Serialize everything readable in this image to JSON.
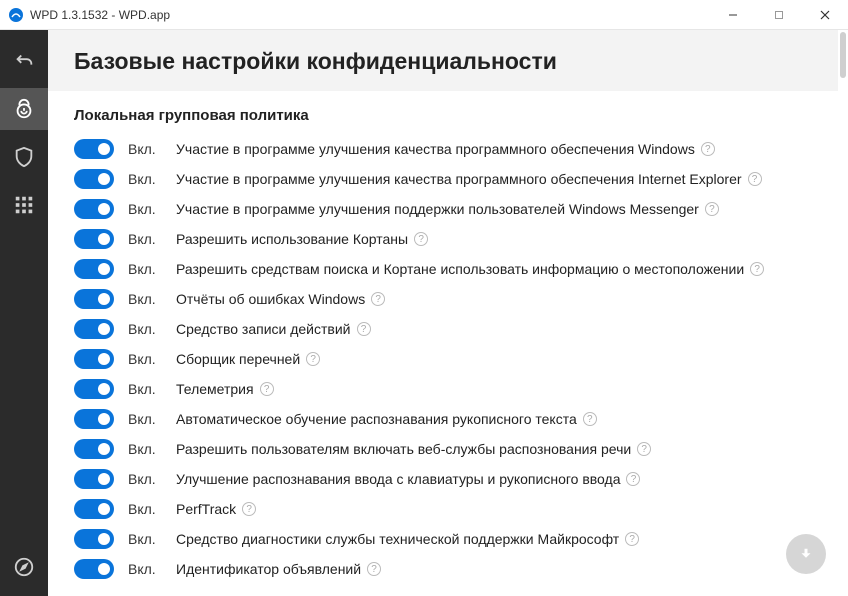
{
  "window": {
    "title": "WPD 1.3.1532 - WPD.app"
  },
  "page": {
    "heading": "Базовые настройки конфиденциальности",
    "section": "Локальная групповая политика"
  },
  "status_on": "Вкл.",
  "settings": [
    {
      "label": "Участие в программе улучшения качества программного обеспечения Windows",
      "on": true
    },
    {
      "label": "Участие в программе улучшения качества программного обеспечения Internet Explorer",
      "on": true
    },
    {
      "label": "Участие в программе улучшения поддержки пользователей Windows Messenger",
      "on": true
    },
    {
      "label": "Разрешить использование Кортаны",
      "on": true
    },
    {
      "label": "Разрешить средствам поиска и Кортане использовать информацию о местоположении",
      "on": true
    },
    {
      "label": "Отчёты об ошибках Windows",
      "on": true
    },
    {
      "label": "Средство записи действий",
      "on": true
    },
    {
      "label": "Сборщик перечней",
      "on": true
    },
    {
      "label": "Телеметрия",
      "on": true
    },
    {
      "label": "Автоматическое обучение распознавания рукописного текста",
      "on": true
    },
    {
      "label": "Разрешить пользователям включать веб-службы распознования речи",
      "on": true
    },
    {
      "label": "Улучшение распознавания ввода с клавиатуры и рукописного ввода",
      "on": true
    },
    {
      "label": "PerfTrack",
      "on": true
    },
    {
      "label": "Средство диагностики службы технической поддержки Майкрософт",
      "on": true
    },
    {
      "label": "Идентификатор объявлений",
      "on": true
    }
  ]
}
